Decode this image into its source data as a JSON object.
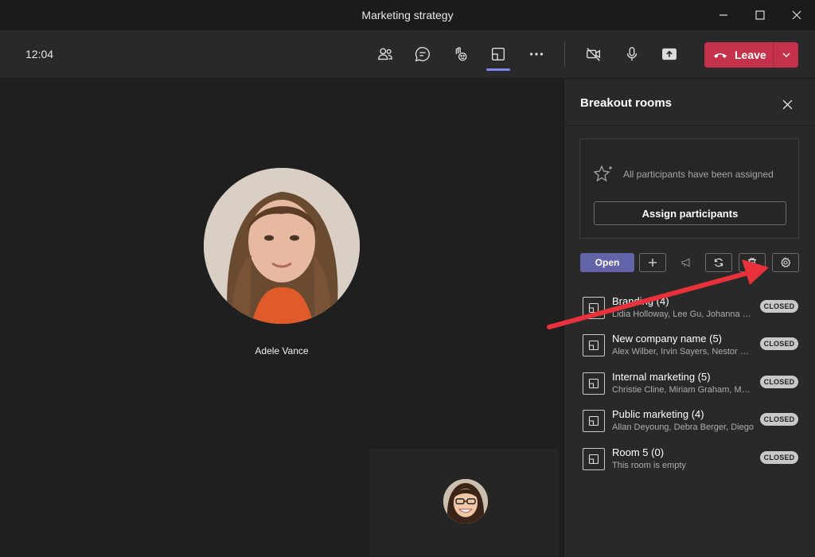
{
  "window": {
    "title": "Marketing strategy"
  },
  "toolbar": {
    "clock": "12:04",
    "leave_label": "Leave"
  },
  "stage": {
    "main_participant": "Adele Vance"
  },
  "panel": {
    "title": "Breakout rooms",
    "assign_message": "All participants have been assigned",
    "assign_button": "Assign participants",
    "open_button": "Open",
    "rooms": [
      {
        "name": "Branding (4)",
        "members": "Lidia Holloway, Lee Gu, Johanna Lorenz, Alex",
        "status": "CLOSED"
      },
      {
        "name": "New company name (5)",
        "members": "Alex Wilber, Irvin Sayers, Nestor Wilke",
        "status": "CLOSED"
      },
      {
        "name": "Internal marketing (5)",
        "members": "Christie Cline, Miriam Graham, Megan",
        "status": "CLOSED"
      },
      {
        "name": "Public marketing (4)",
        "members": "Allan Deyoung, Debra Berger, Diego",
        "status": "CLOSED"
      },
      {
        "name": "Room 5 (0)",
        "members": "This room is empty",
        "status": "CLOSED"
      }
    ]
  },
  "colors": {
    "leave": "#c4314b",
    "accent": "#6264a7",
    "annotation_arrow": "#e8313b"
  }
}
